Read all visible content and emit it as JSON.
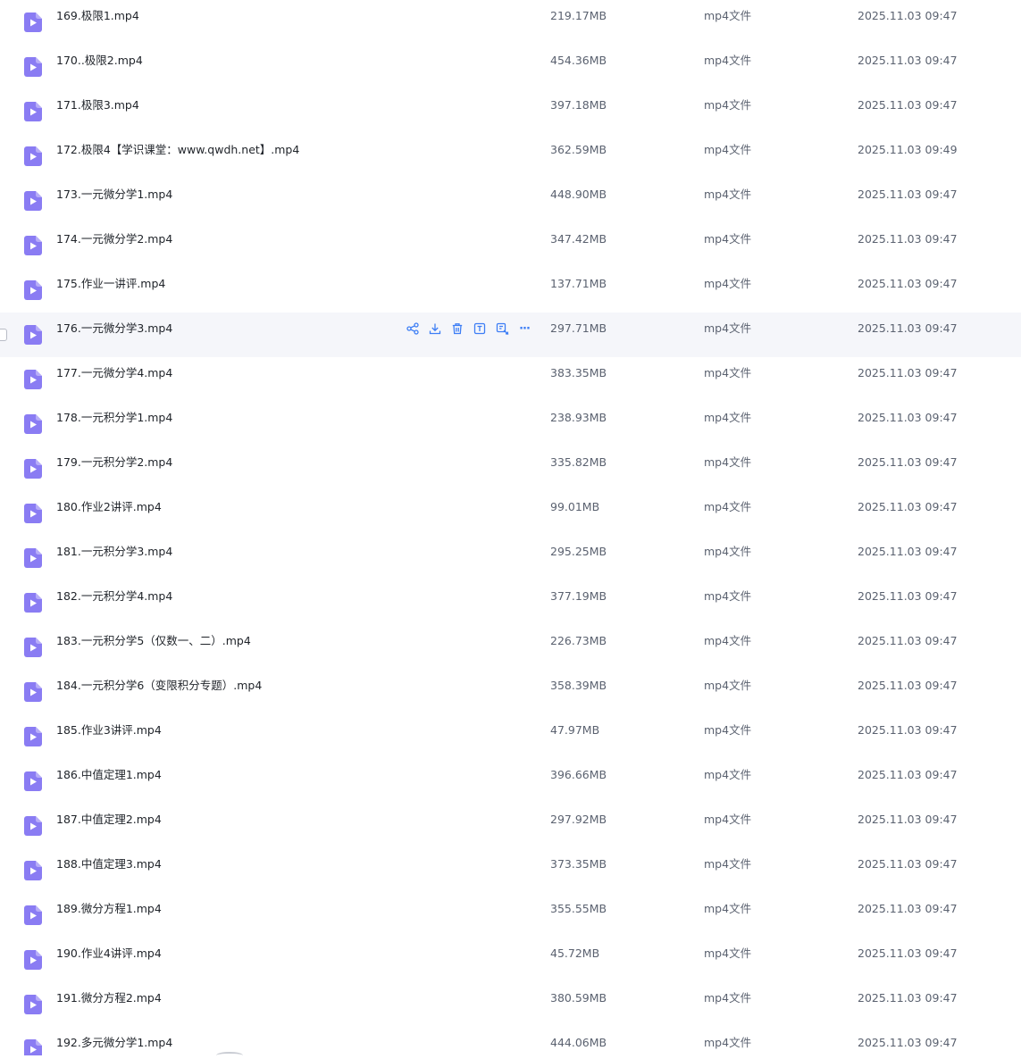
{
  "colors": {
    "icon": "#8a7cf3",
    "action": "#3d7ef5",
    "hover_row": "#f5f6fa"
  },
  "row_icon": "video-file-icon",
  "hovered_row_index": 7,
  "hover_actions": [
    {
      "name": "share-icon"
    },
    {
      "name": "download-icon"
    },
    {
      "name": "delete-icon"
    },
    {
      "name": "rename-icon"
    },
    {
      "name": "copy-move-icon"
    },
    {
      "name": "more-icon",
      "glyph": "···"
    }
  ],
  "files": [
    {
      "name": "169.极限1.mp4",
      "size": "219.17MB",
      "type": "mp4文件",
      "date": "2025.11.03 09:47"
    },
    {
      "name": "170..极限2.mp4",
      "size": "454.36MB",
      "type": "mp4文件",
      "date": "2025.11.03 09:47"
    },
    {
      "name": "171.极限3.mp4",
      "size": "397.18MB",
      "type": "mp4文件",
      "date": "2025.11.03 09:47"
    },
    {
      "name": "172.极限4【学识课堂：www.qwdh.net】.mp4",
      "size": "362.59MB",
      "type": "mp4文件",
      "date": "2025.11.03 09:49"
    },
    {
      "name": "173.一元微分学1.mp4",
      "size": "448.90MB",
      "type": "mp4文件",
      "date": "2025.11.03 09:47"
    },
    {
      "name": "174.一元微分学2.mp4",
      "size": "347.42MB",
      "type": "mp4文件",
      "date": "2025.11.03 09:47"
    },
    {
      "name": "175.作业一讲评.mp4",
      "size": "137.71MB",
      "type": "mp4文件",
      "date": "2025.11.03 09:47"
    },
    {
      "name": "176.一元微分学3.mp4",
      "size": "297.71MB",
      "type": "mp4文件",
      "date": "2025.11.03 09:47"
    },
    {
      "name": "177.一元微分学4.mp4",
      "size": "383.35MB",
      "type": "mp4文件",
      "date": "2025.11.03 09:47"
    },
    {
      "name": "178.一元积分学1.mp4",
      "size": "238.93MB",
      "type": "mp4文件",
      "date": "2025.11.03 09:47"
    },
    {
      "name": "179.一元积分学2.mp4",
      "size": "335.82MB",
      "type": "mp4文件",
      "date": "2025.11.03 09:47"
    },
    {
      "name": "180.作业2讲评.mp4",
      "size": "99.01MB",
      "type": "mp4文件",
      "date": "2025.11.03 09:47"
    },
    {
      "name": "181.一元积分学3.mp4",
      "size": "295.25MB",
      "type": "mp4文件",
      "date": "2025.11.03 09:47"
    },
    {
      "name": "182.一元积分学4.mp4",
      "size": "377.19MB",
      "type": "mp4文件",
      "date": "2025.11.03 09:47"
    },
    {
      "name": "183.一元积分学5（仅数一、二）.mp4",
      "size": "226.73MB",
      "type": "mp4文件",
      "date": "2025.11.03 09:47"
    },
    {
      "name": "184.一元积分学6（变限积分专题）.mp4",
      "size": "358.39MB",
      "type": "mp4文件",
      "date": "2025.11.03 09:47"
    },
    {
      "name": "185.作业3讲评.mp4",
      "size": "47.97MB",
      "type": "mp4文件",
      "date": "2025.11.03 09:47"
    },
    {
      "name": "186.中值定理1.mp4",
      "size": "396.66MB",
      "type": "mp4文件",
      "date": "2025.11.03 09:47"
    },
    {
      "name": "187.中值定理2.mp4",
      "size": "297.92MB",
      "type": "mp4文件",
      "date": "2025.11.03 09:47"
    },
    {
      "name": "188.中值定理3.mp4",
      "size": "373.35MB",
      "type": "mp4文件",
      "date": "2025.11.03 09:47"
    },
    {
      "name": "189.微分方程1.mp4",
      "size": "355.55MB",
      "type": "mp4文件",
      "date": "2025.11.03 09:47"
    },
    {
      "name": "190.作业4讲评.mp4",
      "size": "45.72MB",
      "type": "mp4文件",
      "date": "2025.11.03 09:47"
    },
    {
      "name": "191.微分方程2.mp4",
      "size": "380.59MB",
      "type": "mp4文件",
      "date": "2025.11.03 09:47"
    },
    {
      "name": "192.多元微分学1.mp4",
      "size": "444.06MB",
      "type": "mp4文件",
      "date": "2025.11.03 09:47"
    }
  ]
}
